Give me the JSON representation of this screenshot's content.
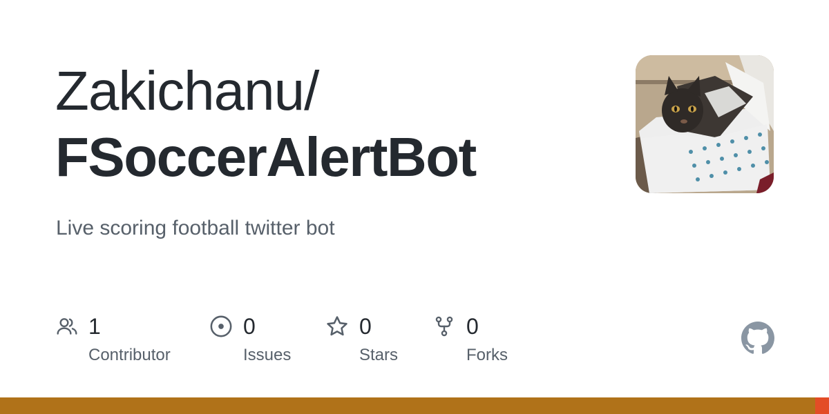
{
  "repo": {
    "owner": "Zakichanu/",
    "name": "FSoccerAlertBot",
    "description": "Live scoring football twitter bot"
  },
  "stats": [
    {
      "icon": "people-icon",
      "value": "1",
      "label": "Contributor"
    },
    {
      "icon": "issue-icon",
      "value": "0",
      "label": "Issues"
    },
    {
      "icon": "star-icon",
      "value": "0",
      "label": "Stars"
    },
    {
      "icon": "fork-icon",
      "value": "0",
      "label": "Forks"
    }
  ],
  "languages": [
    {
      "color": "#b07219",
      "share": 0.983
    },
    {
      "color": "#e34c26",
      "share": 0.017
    }
  ],
  "colors": {
    "text_primary": "#24292f",
    "text_secondary": "#57606a",
    "icon": "#57606a",
    "github_logo": "#8a96a3"
  }
}
